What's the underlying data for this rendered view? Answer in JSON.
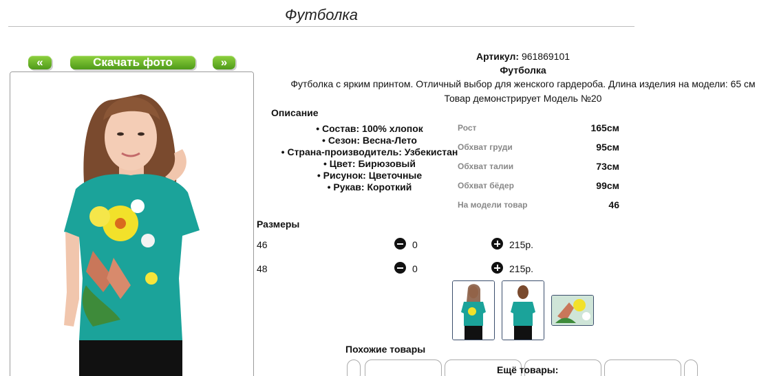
{
  "page": {
    "title": "Футболка"
  },
  "gallery": {
    "prev_label": "«",
    "download_label": "Скачать фото",
    "next_label": "»"
  },
  "product": {
    "article_label": "Артикул:",
    "article_value": "961869101",
    "name": "Футболка",
    "description": "Футболка с ярким принтом. Отличный выбор для женского гардероба. Длина изделия на модели: 65 см",
    "model_note": "Товар демонстрирует Модель №20"
  },
  "description_block": {
    "title": "Описание",
    "attributes": [
      "• Состав: 100% хлопок",
      "• Сезон: Весна-Лето",
      "• Страна-производитель: Узбекистан",
      "• Цвет: Бирюзовый",
      "• Рисунок: Цветочные",
      "• Рукав: Короткий"
    ]
  },
  "model_params": [
    {
      "label": "Рост",
      "value": "165см"
    },
    {
      "label": "Обхват груди",
      "value": "95см"
    },
    {
      "label": "Обхват талии",
      "value": "73см"
    },
    {
      "label": "Обхват бёдер",
      "value": "99см"
    },
    {
      "label": "На модели товар",
      "value": "46"
    }
  ],
  "sizes": {
    "title": "Размеры",
    "rows": [
      {
        "size": "46",
        "qty": "0",
        "price": "215р."
      },
      {
        "size": "48",
        "qty": "0",
        "price": "215р."
      }
    ]
  },
  "similar": {
    "title": "Похожие товары"
  },
  "more": {
    "title": "Ещё товары:"
  },
  "colors": {
    "button_green": "#5aa820",
    "shirt_teal": "#1ba39a"
  }
}
